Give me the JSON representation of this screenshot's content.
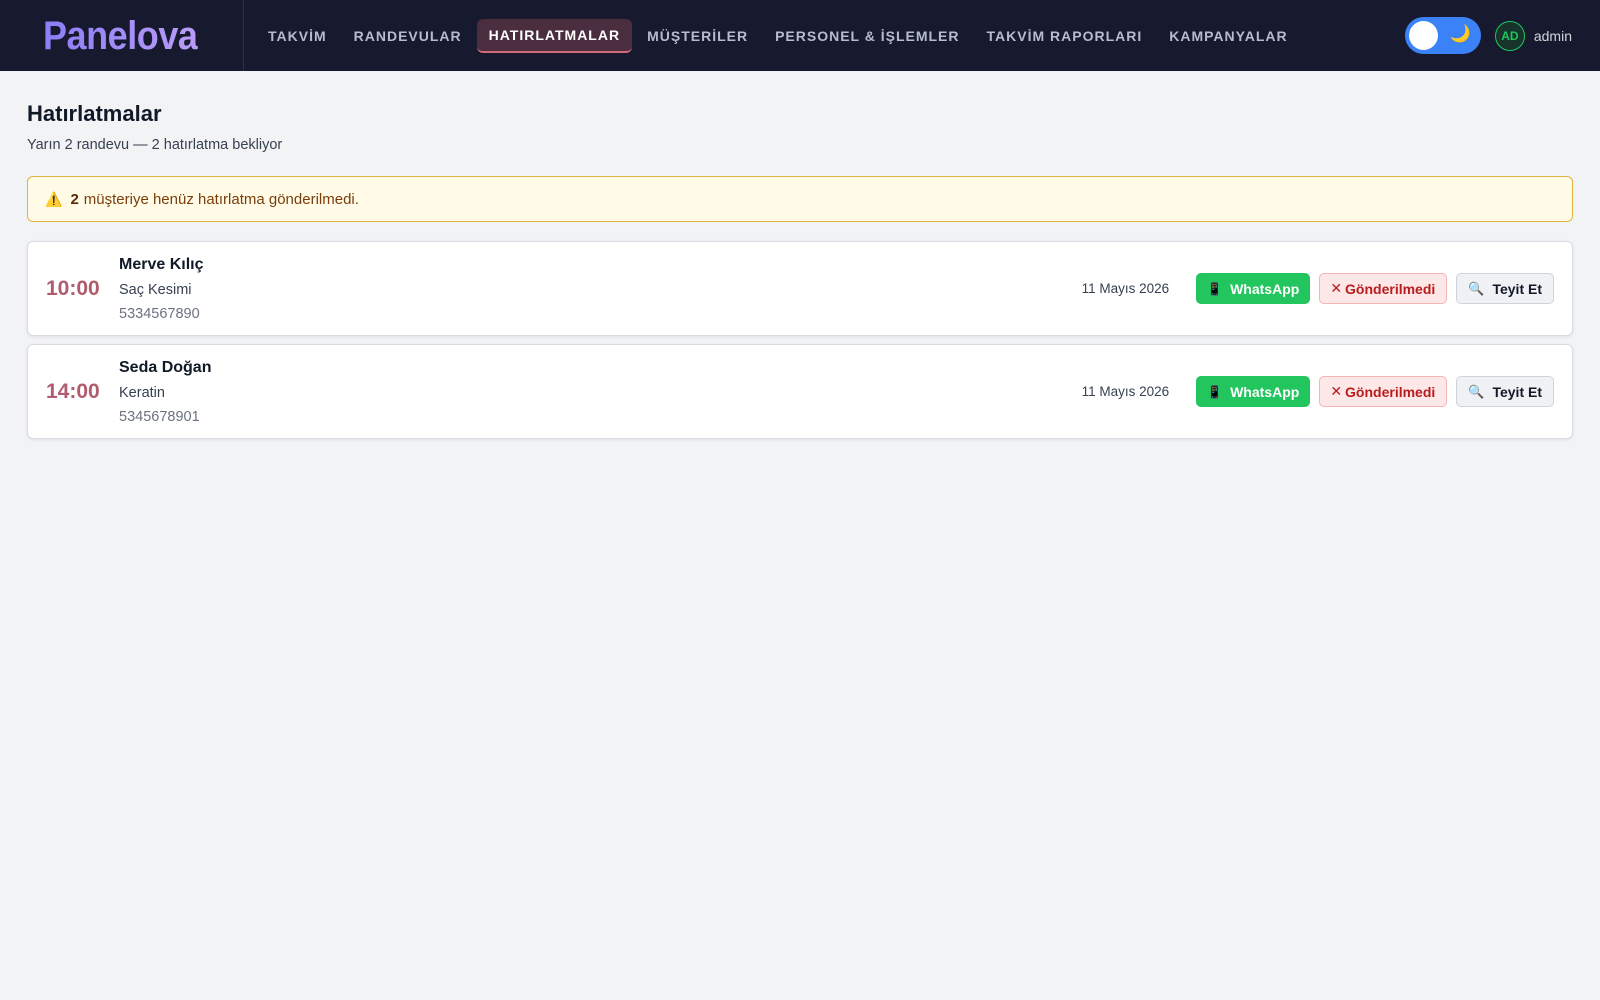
{
  "brand": {
    "logo": "Panelova"
  },
  "nav": {
    "tabs": [
      {
        "label": "TAKVİM"
      },
      {
        "label": "RANDEVULAR"
      },
      {
        "label": "HATIRLATMALAR",
        "active": true
      },
      {
        "label": "MÜŞTERİLER"
      },
      {
        "label": "PERSONEL & İŞLEMLER"
      },
      {
        "label": "TAKVİM RAPORLARI"
      },
      {
        "label": "KAMPANYALAR"
      }
    ]
  },
  "header_right": {
    "theme_toggle_icon": "moon-icon",
    "avatar_initials": "AD",
    "username": "admin"
  },
  "page": {
    "title": "Hatırlatmalar",
    "subtitle": "Yarın 2 randevu — 2 hatırlatma bekliyor"
  },
  "alert": {
    "icon": "⚠️",
    "count": "2",
    "message": "müşteriye henüz hatırlatma gönderilmedi."
  },
  "reminders": [
    {
      "time": "10:00",
      "name": "Merve Kılıç",
      "service": "Saç Kesimi",
      "phone": "5334567890",
      "date": "11 Mayıs 2026",
      "whatsapp_label": "WhatsApp",
      "status_label": "Gönderilmedi",
      "confirm_label": "Teyit Et"
    },
    {
      "time": "14:00",
      "name": "Seda Doğan",
      "service": "Keratin",
      "phone": "5345678901",
      "date": "11 Mayıs 2026",
      "whatsapp_label": "WhatsApp",
      "status_label": "Gönderilmedi",
      "confirm_label": "Teyit Et"
    }
  ],
  "icons": {
    "whatsapp": "📱",
    "not_sent": "✕",
    "confirm": "🔍"
  },
  "colors": {
    "topbar": "#171a2e",
    "accent_time": "#b05c6d",
    "whatsapp_green": "#22c55e",
    "not_sent_red": "#b91c1c",
    "alert_border": "#e3b341"
  }
}
